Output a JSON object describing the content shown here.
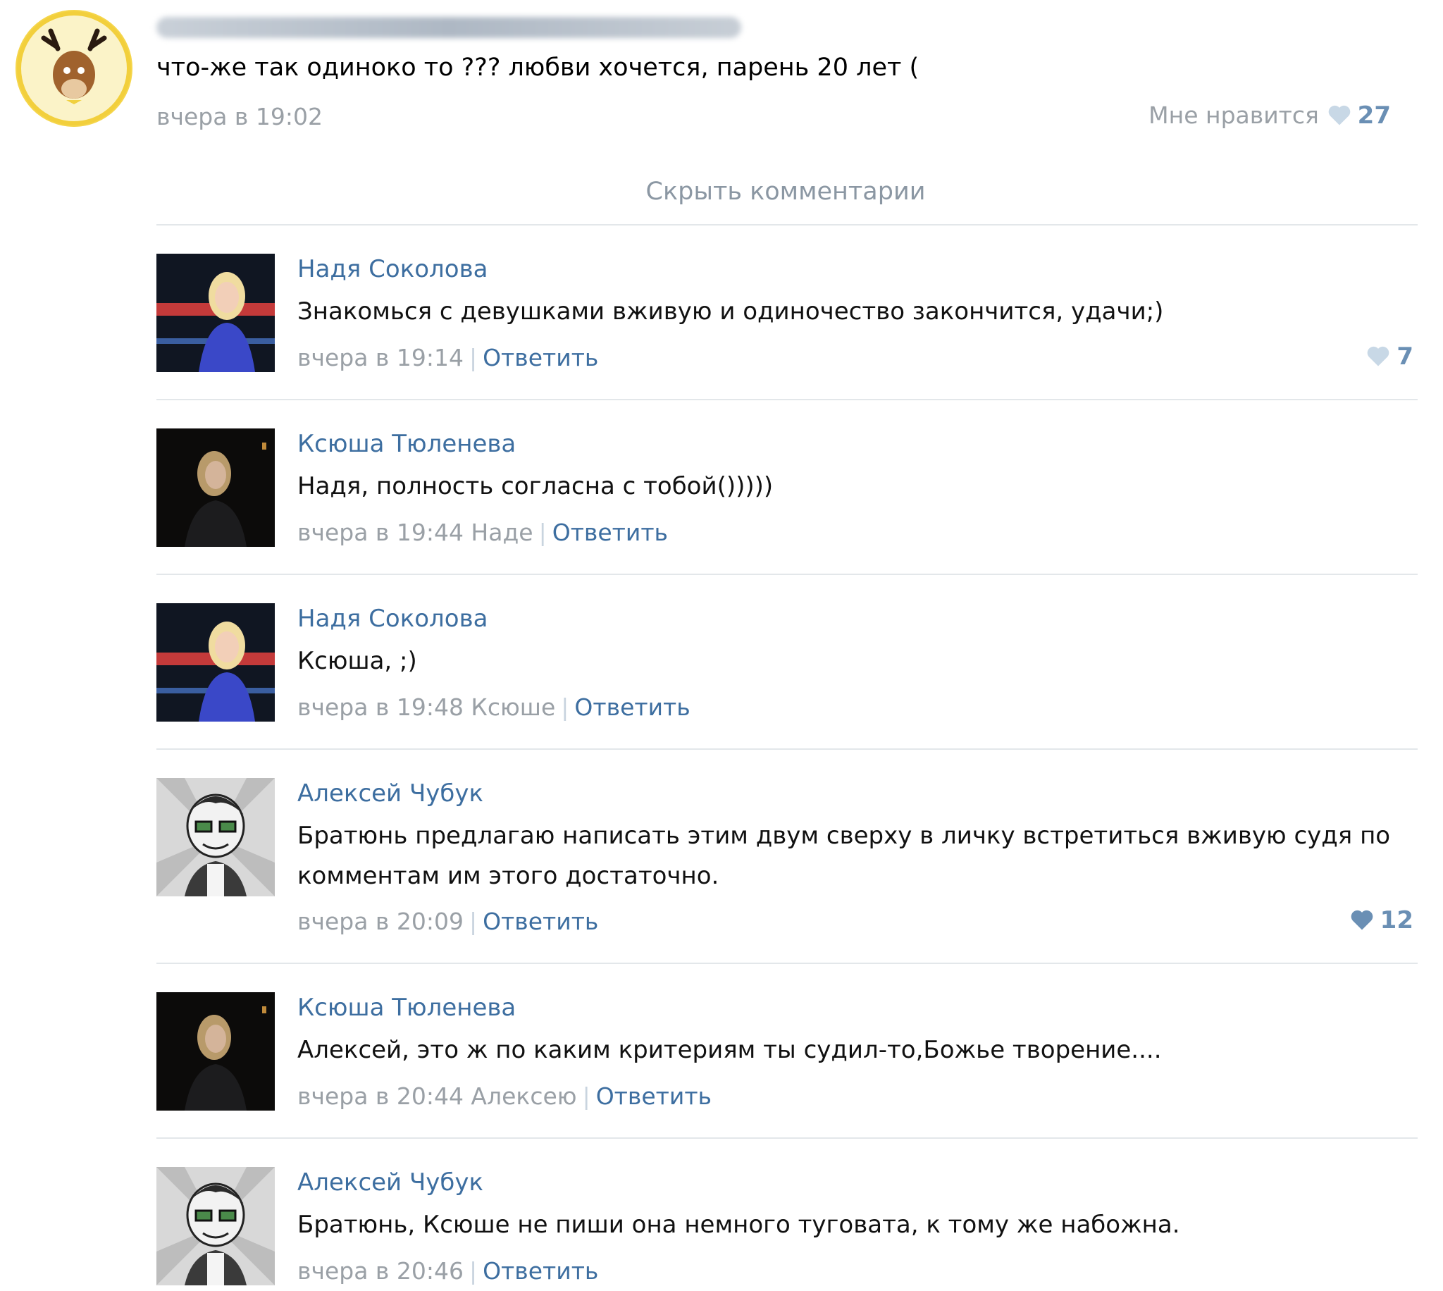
{
  "post": {
    "text": "что-же так одиноко то ??? любви хочется, парень 20 лет (",
    "time": "вчера в 19:02",
    "like_label": "Мне нравится",
    "like_count": "27"
  },
  "hide_comments": "Скрыть комментарии",
  "comments": [
    {
      "author": "Надя Соколова",
      "text": "Знакомься с девушками вживую и одиночество закончится, удачи;)",
      "time": "вчера в 19:14",
      "reply": "Ответить",
      "likes": "7"
    },
    {
      "author": "Ксюша Тюленева",
      "text": "Надя, полность согласна с тобой()))))",
      "time": "вчера в 19:44 Наде",
      "reply": "Ответить"
    },
    {
      "author": "Надя Соколова",
      "text": "Ксюша, ;)",
      "time": "вчера в 19:48 Ксюше",
      "reply": "Ответить"
    },
    {
      "author": "Алексей Чубук",
      "text": "Братюнь предлагаю написать этим двум сверху в личку встретиться вживую судя по комментам им этого достаточно.",
      "time": "вчера в 20:09",
      "reply": "Ответить",
      "likes": "12"
    },
    {
      "author": "Ксюша Тюленева",
      "text": "Алексей, это ж по каким критериям ты судил-то,Божье творение....",
      "time": "вчера в 20:44 Алексею",
      "reply": "Ответить"
    },
    {
      "author": "Алексей Чубук",
      "text": "Братюнь, Ксюше не пиши она немного туговата, к тому же набожна.",
      "time": "вчера в 20:46",
      "reply": "Ответить"
    }
  ],
  "colors": {
    "link": "#3d6ea0",
    "meta": "#9aa0a6",
    "heart_light": "#c8d8e6",
    "heart_dark": "#6a8fb4"
  }
}
